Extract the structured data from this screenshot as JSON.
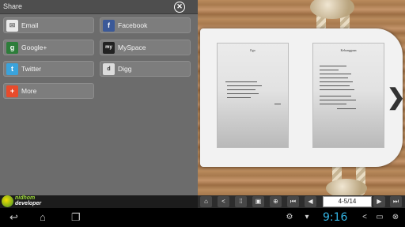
{
  "share": {
    "title": "Share",
    "close_icon": "close-icon",
    "buttons": [
      {
        "label": "Email",
        "icon": "email-icon"
      },
      {
        "label": "Facebook",
        "icon": "facebook-icon"
      },
      {
        "label": "Google+",
        "icon": "google-plus-icon"
      },
      {
        "label": "MySpace",
        "icon": "myspace-icon"
      },
      {
        "label": "Twitter",
        "icon": "twitter-icon"
      },
      {
        "label": "Digg",
        "icon": "digg-icon"
      },
      {
        "label": "More",
        "icon": "more-icon"
      }
    ]
  },
  "logo": {
    "line1": "nidhom",
    "line2": "developer"
  },
  "book": {
    "left_page_title": "Ego",
    "right_page_title": "Kebanggaan"
  },
  "toolbar": {
    "page_indicator": "4-5/14",
    "icons": [
      "home-icon",
      "share-icon",
      "grid-icon",
      "pages-icon",
      "zoom-icon",
      "first-page-icon",
      "prev-page-icon",
      "next-page-icon",
      "last-page-icon"
    ]
  },
  "system_bar": {
    "time": "9:16",
    "nav_icons": [
      "back-icon",
      "home-icon",
      "recent-apps-icon"
    ],
    "status_icons": [
      "usb-icon",
      "download-icon",
      "share-icon",
      "screen-icon",
      "close-icon"
    ]
  },
  "colors": {
    "clock": "#33b5e5",
    "share_bg": "#6c6c6c",
    "wood": "#b98a5c"
  }
}
